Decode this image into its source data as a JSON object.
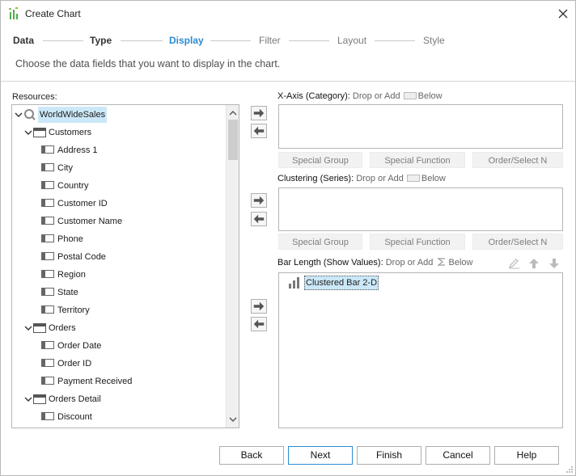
{
  "window": {
    "title": "Create Chart"
  },
  "steps": [
    {
      "label": "Data",
      "state": "done"
    },
    {
      "label": "Type",
      "state": "done"
    },
    {
      "label": "Display",
      "state": "active"
    },
    {
      "label": "Filter",
      "state": "pending"
    },
    {
      "label": "Layout",
      "state": "pending"
    },
    {
      "label": "Style",
      "state": "pending"
    }
  ],
  "subtitle": "Choose the data fields that you want to display in the chart.",
  "resources": {
    "label": "Resources:",
    "root": "WorldWideSales",
    "tree": [
      {
        "label": "Customers",
        "type": "table",
        "children": [
          "Address 1",
          "City",
          "Country",
          "Customer ID",
          "Customer Name",
          "Phone",
          "Postal Code",
          "Region",
          "State",
          "Territory"
        ]
      },
      {
        "label": "Orders",
        "type": "table",
        "children": [
          "Order Date",
          "Order ID",
          "Payment Received"
        ]
      },
      {
        "label": "Orders Detail",
        "type": "table",
        "children": [
          "Discount"
        ]
      }
    ]
  },
  "xaxis": {
    "label": "X-Axis (Category):",
    "hint": "Drop or Add",
    "below": "Below"
  },
  "clustering": {
    "label": "Clustering (Series):",
    "hint": "Drop or Add",
    "below": "Below"
  },
  "barlength": {
    "label": "Bar Length (Show Values):",
    "hint": "Drop or Add",
    "below": "Below",
    "item": "Clustered Bar 2-D"
  },
  "fn_buttons": {
    "special_group": "Special Group",
    "special_function": "Special Function",
    "order_select": "Order/Select N"
  },
  "footer": {
    "back": "Back",
    "next": "Next",
    "finish": "Finish",
    "cancel": "Cancel",
    "help": "Help"
  },
  "colors": {
    "accent": "#2a8bd2",
    "selection": "#cce8f8",
    "disabled_text": "#7d7d7d"
  }
}
